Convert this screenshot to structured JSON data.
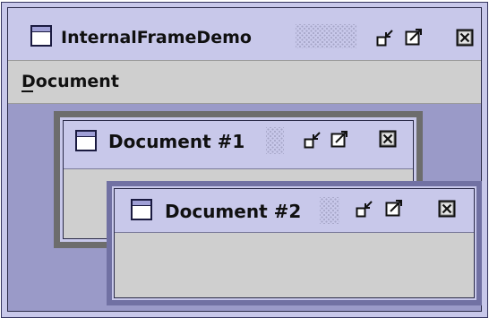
{
  "main_window": {
    "title": "InternalFrameDemo",
    "menu": {
      "items": [
        {
          "label": "Document",
          "mnemonic": "D"
        }
      ]
    }
  },
  "internal_frames": [
    {
      "title": "Document #1"
    },
    {
      "title": "Document #2"
    }
  ],
  "icons": {
    "frame_icon": "window-icon",
    "iconify": "iconify-icon",
    "maximize": "maximize-icon",
    "close": "close-icon"
  },
  "colors": {
    "title_bar": "#c8c8ea",
    "desktop": "#9a9ac8",
    "content": "#cfcfcf",
    "doc1_border": "#6d6d6d",
    "doc2_border": "#7171a3"
  }
}
